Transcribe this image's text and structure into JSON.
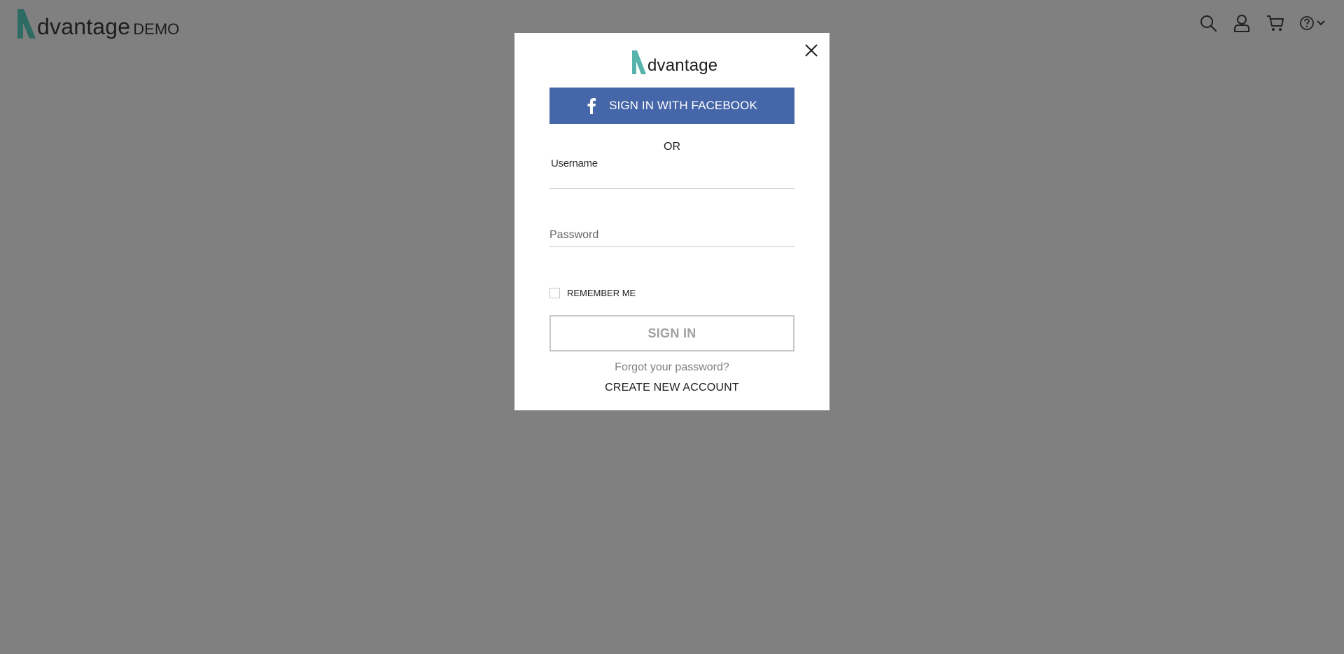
{
  "header": {
    "logo_text": "dvantage",
    "logo_suffix": "DEMO",
    "icons": [
      "search-icon",
      "user-icon",
      "cart-icon",
      "help-icon",
      "chevron-down-icon"
    ]
  },
  "modal": {
    "logo_text": "dvantage",
    "facebook_label": "SIGN IN WITH FACEBOOK",
    "or_text": "OR",
    "username_label": "Username",
    "username_value": "",
    "password_placeholder": "Password",
    "password_value": "",
    "remember_label": "REMEMBER ME",
    "remember_checked": false,
    "signin_label": "SIGN IN",
    "forgot_label": "Forgot your password?",
    "create_label": "CREATE NEW ACCOUNT"
  },
  "colors": {
    "overlay": "#808080",
    "brand_teal": "#2e7d73",
    "brand_teal_light": "#57b3ab",
    "facebook_blue": "#4566a8"
  }
}
